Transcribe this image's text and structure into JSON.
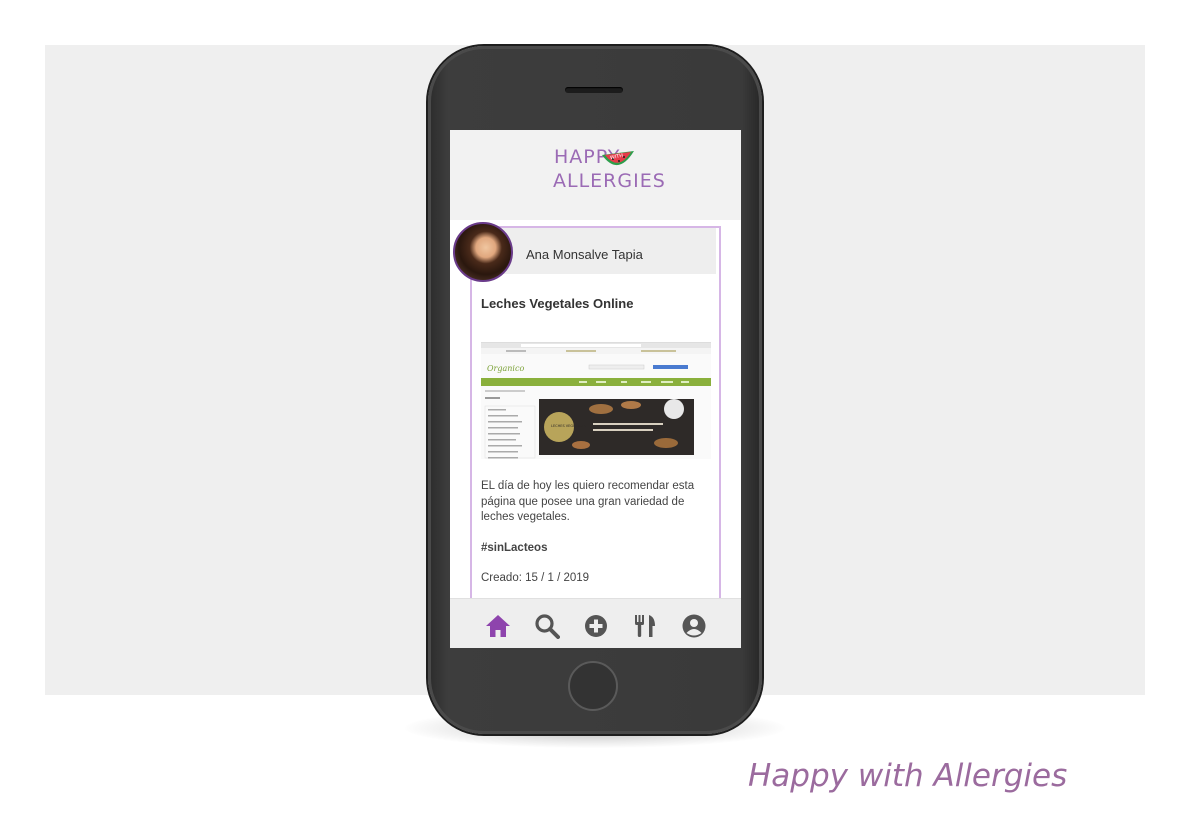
{
  "logo": {
    "line1": "HAPPY",
    "line2": "ALLERGIES",
    "badge": "WITH"
  },
  "post": {
    "author": "Ana Monsalve Tapia",
    "title": "Leches Vegetales Online",
    "body": "EL día de hoy les quiero recomendar esta página que posee una gran variedad de leches vegetales.",
    "tag": "#sinLacteos",
    "created": "Creado: 15 / 1 / 2019"
  },
  "screenshot_thumb": {
    "site_logo": "Organico",
    "banner_badge": "LECHES VEGETALES"
  },
  "tabbar": {
    "items": [
      "home-icon",
      "search-icon",
      "add-circle-icon",
      "restaurant-icon",
      "account-icon"
    ],
    "active": "home-icon",
    "active_color": "#8e44ad",
    "inactive_color": "#555555"
  },
  "caption": "Happy with Allergies",
  "colors": {
    "accent": "#9b6bb5",
    "card_border": "#d6b6e6"
  }
}
